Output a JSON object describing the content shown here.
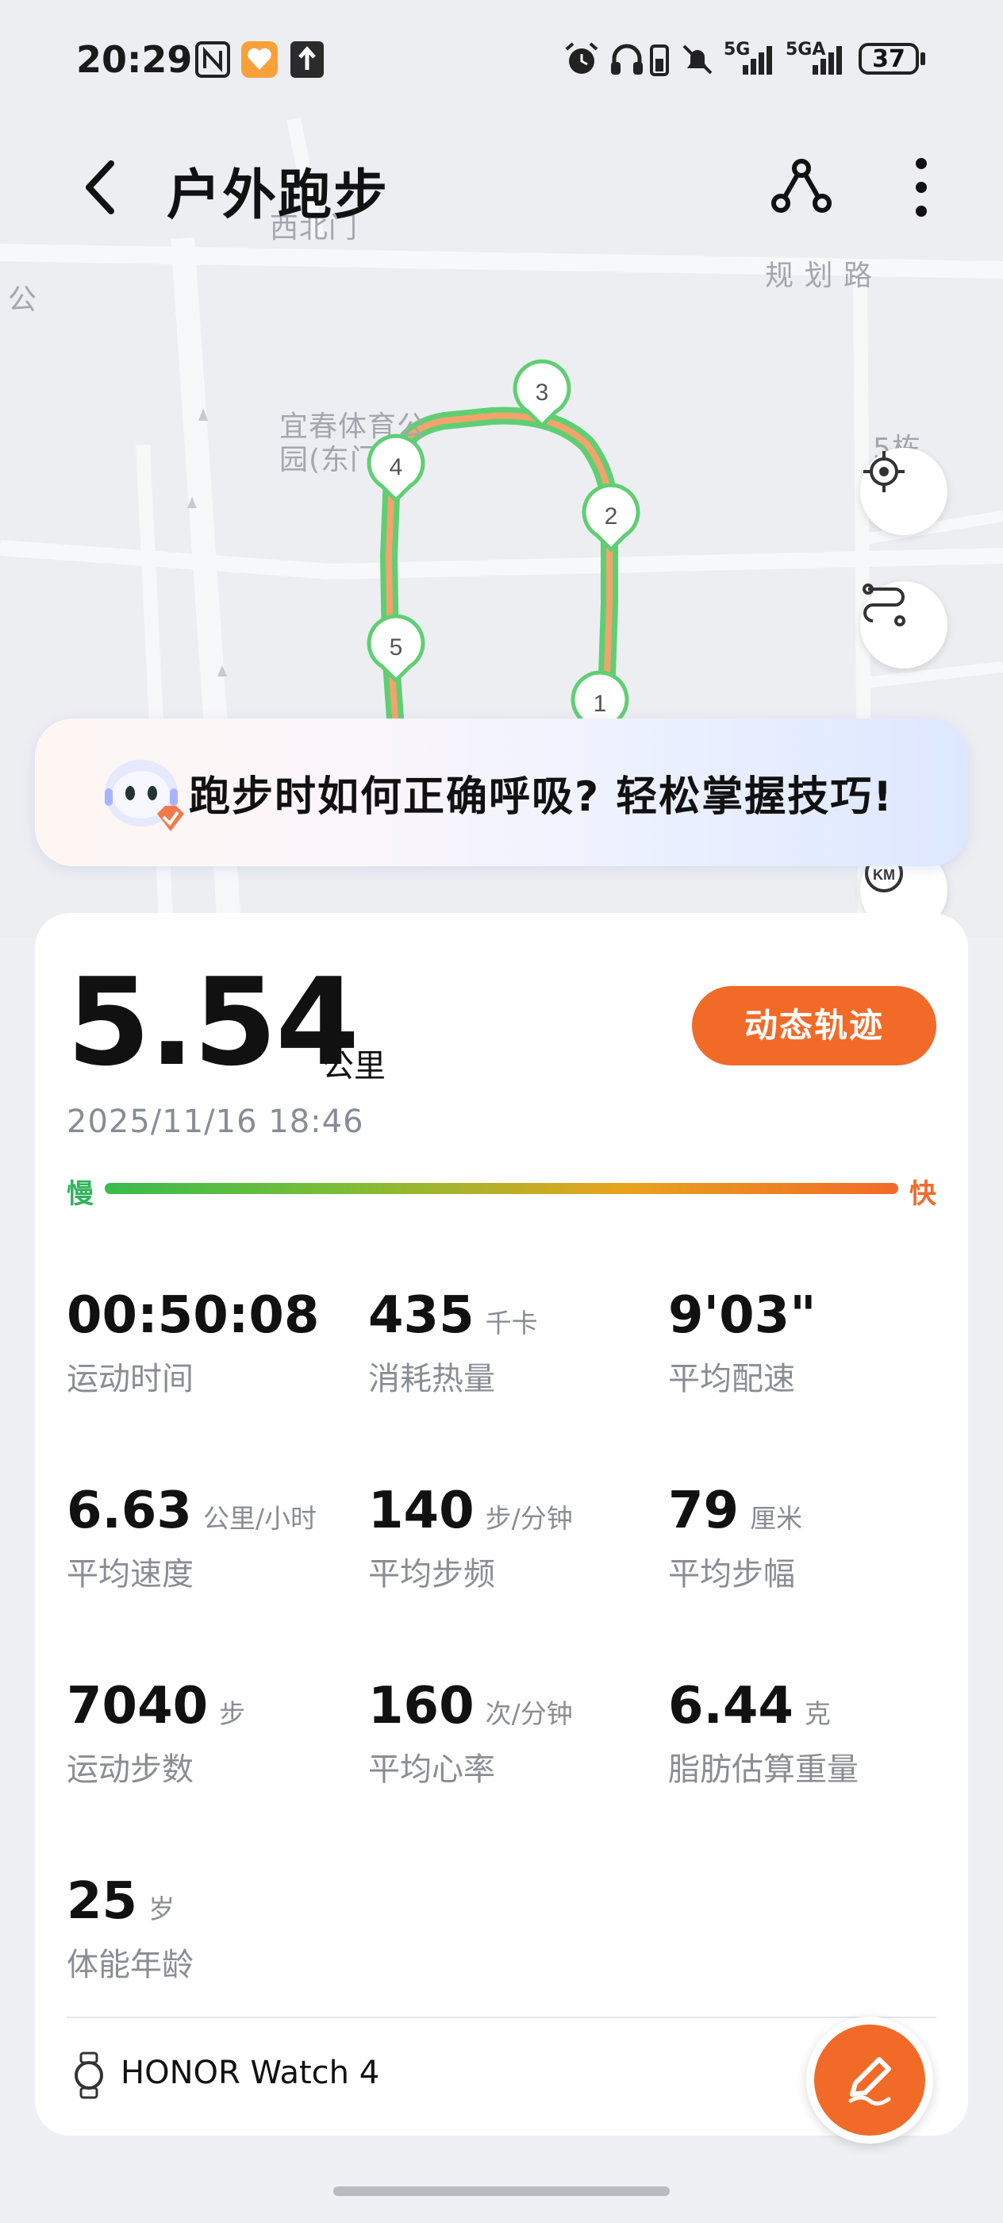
{
  "status_bar": {
    "time": "20:29",
    "battery": "37",
    "net1": "5G",
    "net2": "5GA",
    "icons": [
      "nfc-icon",
      "health-app-icon",
      "upload-icon",
      "alarm-icon",
      "headphones-icon",
      "earbud-battery-icon",
      "mute-icon",
      "signal-icon",
      "battery-icon"
    ]
  },
  "header": {
    "title": "户外跑步",
    "back_icon": "chevron-left-icon",
    "route_icon": "route-share-icon",
    "more_icon": "more-vertical-icon"
  },
  "map": {
    "labels": {
      "north_gate": "西北门",
      "road": "规 划 路",
      "park": "宜春体育公",
      "park2": "园(东门",
      "left_edge": "公",
      "left_edge2": "门",
      "building": "5栋"
    },
    "km_markers": [
      "1",
      "2",
      "3",
      "4",
      "5"
    ],
    "buttons": [
      "locate-icon",
      "route-toggle-icon",
      "km-timer-icon"
    ],
    "route_color": "#5fcf73",
    "route_inner_color": "#f4a36d"
  },
  "tip": {
    "text": "跑步时如何正确呼吸? 轻松掌握技巧!"
  },
  "summary": {
    "distance": "5.54",
    "distance_unit": "公里",
    "datetime": "2025/11/16 18:46",
    "dynamic_track_button": "动态轨迹",
    "pace_slow": "慢",
    "pace_fast": "快",
    "accent": "#f26a28",
    "green": "#2fb35a"
  },
  "stats": [
    {
      "value": "00:50:08",
      "unit": "",
      "label": "运动时间"
    },
    {
      "value": "435",
      "unit": "千卡",
      "label": "消耗热量"
    },
    {
      "value": "9'03\"",
      "unit": "",
      "label": "平均配速"
    },
    {
      "value": "6.63",
      "unit": "公里/小时",
      "label": "平均速度"
    },
    {
      "value": "140",
      "unit": "步/分钟",
      "label": "平均步频"
    },
    {
      "value": "79",
      "unit": "厘米",
      "label": "平均步幅"
    },
    {
      "value": "7040",
      "unit": "步",
      "label": "运动步数"
    },
    {
      "value": "160",
      "unit": "次/分钟",
      "label": "平均心率"
    },
    {
      "value": "6.44",
      "unit": "克",
      "label": "脂肪估算重量"
    },
    {
      "value": "25",
      "unit": "岁",
      "label": "体能年龄"
    }
  ],
  "device": {
    "name": "HONOR Watch 4",
    "icon": "watch-icon"
  },
  "fab": {
    "icon": "edit-pen-icon"
  }
}
